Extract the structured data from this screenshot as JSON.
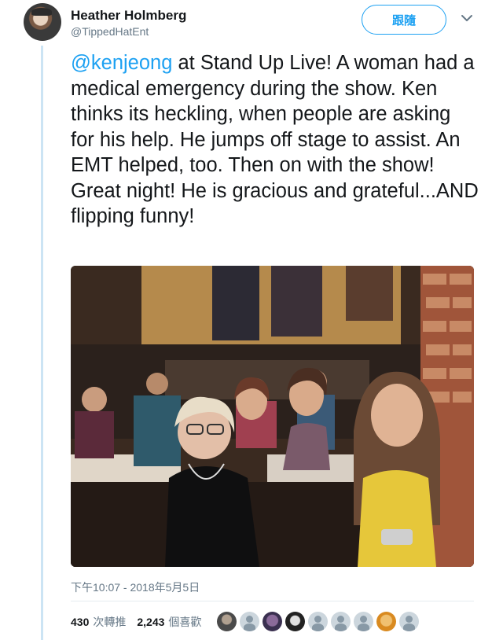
{
  "user": {
    "name": "Heather Holmberg",
    "handle": "@TippedHatEnt"
  },
  "follow_label": "跟隨",
  "tweet": {
    "mention": "@kenjeong",
    "text": " at Stand Up Live! A woman had a medical emergency during the show. Ken thinks its heckling, when people are asking for his help. He jumps off stage to assist. An EMT helped, too. Then on with the show! Great night! He is gracious and grateful...AND flipping funny!"
  },
  "timestamp": "下午10:07 - 2018年5月5日",
  "stats": {
    "retweets_count": "430",
    "retweets_label": "次轉推",
    "likes_count": "2,243",
    "likes_label": "個喜歡"
  },
  "likers": [
    "photo",
    "default",
    "photo-dark",
    "photo-mono",
    "default",
    "default",
    "default",
    "photo-orange",
    "default"
  ],
  "colors": {
    "accent": "#1da1f2",
    "text": "#14171a",
    "muted": "#657786",
    "thread": "#cce4f4"
  }
}
